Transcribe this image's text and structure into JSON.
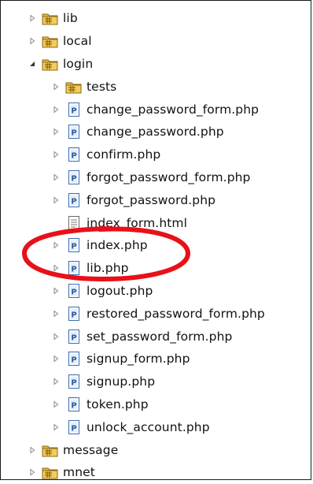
{
  "tree": {
    "items": [
      {
        "label": "lib",
        "type": "folder",
        "state": "collapsed",
        "level": 0
      },
      {
        "label": "local",
        "type": "folder",
        "state": "collapsed",
        "level": 0
      },
      {
        "label": "login",
        "type": "folder",
        "state": "expanded",
        "level": 0
      },
      {
        "label": "tests",
        "type": "folder",
        "state": "collapsed",
        "level": 1
      },
      {
        "label": "change_password_form.php",
        "type": "php",
        "state": "collapsed",
        "level": 1
      },
      {
        "label": "change_password.php",
        "type": "php",
        "state": "collapsed",
        "level": 1
      },
      {
        "label": "confirm.php",
        "type": "php",
        "state": "collapsed",
        "level": 1
      },
      {
        "label": "forgot_password_form.php",
        "type": "php",
        "state": "collapsed",
        "level": 1
      },
      {
        "label": "forgot_password.php",
        "type": "php",
        "state": "collapsed",
        "level": 1
      },
      {
        "label": "index_form.html",
        "type": "html",
        "state": "none",
        "level": 1
      },
      {
        "label": "index.php",
        "type": "php",
        "state": "collapsed",
        "level": 1
      },
      {
        "label": "lib.php",
        "type": "php",
        "state": "collapsed",
        "level": 1
      },
      {
        "label": "logout.php",
        "type": "php",
        "state": "collapsed",
        "level": 1
      },
      {
        "label": "restored_password_form.php",
        "type": "php",
        "state": "collapsed",
        "level": 1
      },
      {
        "label": "set_password_form.php",
        "type": "php",
        "state": "collapsed",
        "level": 1
      },
      {
        "label": "signup_form.php",
        "type": "php",
        "state": "collapsed",
        "level": 1
      },
      {
        "label": "signup.php",
        "type": "php",
        "state": "collapsed",
        "level": 1
      },
      {
        "label": "token.php",
        "type": "php",
        "state": "collapsed",
        "level": 1
      },
      {
        "label": "unlock_account.php",
        "type": "php",
        "state": "collapsed",
        "level": 1
      },
      {
        "label": "message",
        "type": "folder",
        "state": "collapsed",
        "level": 0
      },
      {
        "label": "mnet",
        "type": "folder",
        "state": "collapsed",
        "level": 0
      }
    ]
  },
  "highlight": {
    "target": "index.php",
    "color": "#e8101a"
  },
  "colors": {
    "folder": "#e9b63c",
    "php_icon_border": "#3c6fb0",
    "php_icon_letter": "#2a5aa0",
    "twisty": "#8a8a8a"
  },
  "icons": {
    "folder": "folder-icon",
    "php": "php-file-icon",
    "html": "html-file-icon",
    "collapsed": "chevron-right-icon",
    "expanded": "chevron-down-icon"
  }
}
